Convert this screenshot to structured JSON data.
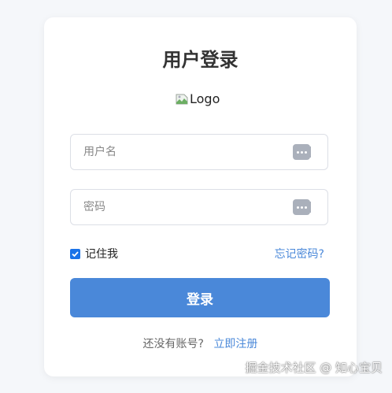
{
  "login_card": {
    "title": "用户登录",
    "logo_alt": "Logo",
    "username_placeholder": "用户名",
    "password_placeholder": "密码",
    "remember_label": "记住我",
    "remember_checked": true,
    "forgot_link": "忘记密码?",
    "login_button": "登录",
    "register_prompt": "还没有账号?",
    "register_link": "立即注册"
  },
  "icons": {
    "field_icon": "password-manager-key-icon",
    "logo_icon": "broken-image-icon",
    "checkbox_icon": "checkmark-icon"
  },
  "colors": {
    "accent": "#4a88d9",
    "checkbox": "#1a73e8",
    "border": "#dcdfe6",
    "background": "#f5f7fa"
  },
  "watermark": "掘金技术社区 @ 知心宝贝"
}
